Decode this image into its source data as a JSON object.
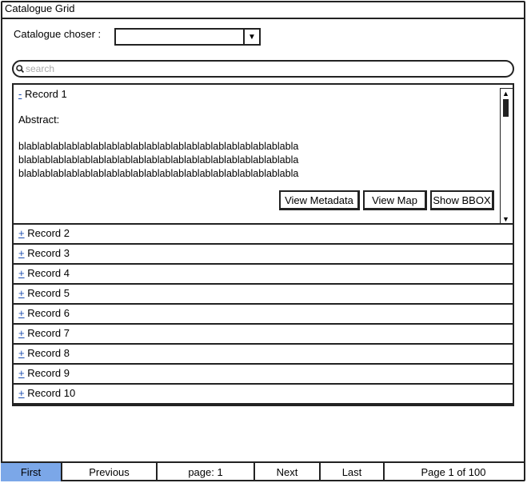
{
  "window": {
    "title": "Catalogue Grid"
  },
  "chooser": {
    "label": "Catalogue choser :",
    "value": ""
  },
  "search": {
    "placeholder": "search",
    "value": ""
  },
  "records": {
    "expanded": {
      "toggle": "-",
      "title": "Record 1",
      "abstract_label": "Abstract:",
      "abstract_lines": [
        "blablablablablablablablablablablablablablablablablablablablabla",
        "blablablablablablablablablablablablablablablablablablablablabla",
        "blablablablablablablablablablablablablablablablablablablablabla"
      ],
      "buttons": {
        "view_metadata": "View Metadata",
        "view_map": "View Map",
        "show_bbox": "Show BBOX"
      }
    },
    "collapsed": [
      {
        "toggle": "+",
        "title": "Record 2"
      },
      {
        "toggle": "+",
        "title": "Record 3"
      },
      {
        "toggle": "+",
        "title": "Record 4"
      },
      {
        "toggle": "+",
        "title": "Record 5"
      },
      {
        "toggle": "+",
        "title": "Record 6"
      },
      {
        "toggle": "+",
        "title": "Record 7"
      },
      {
        "toggle": "+",
        "title": "Record 8"
      },
      {
        "toggle": "+",
        "title": "Record 9"
      },
      {
        "toggle": "+",
        "title": "Record 10"
      }
    ]
  },
  "pager": {
    "first": "First",
    "previous": "Previous",
    "page_input": "page: 1",
    "next": "Next",
    "last": "Last",
    "page_info": "Page 1 of 100",
    "active_color": "#7ba7e8"
  },
  "icons": {
    "search": "search-icon",
    "dropdown": "chevron-down-icon"
  }
}
